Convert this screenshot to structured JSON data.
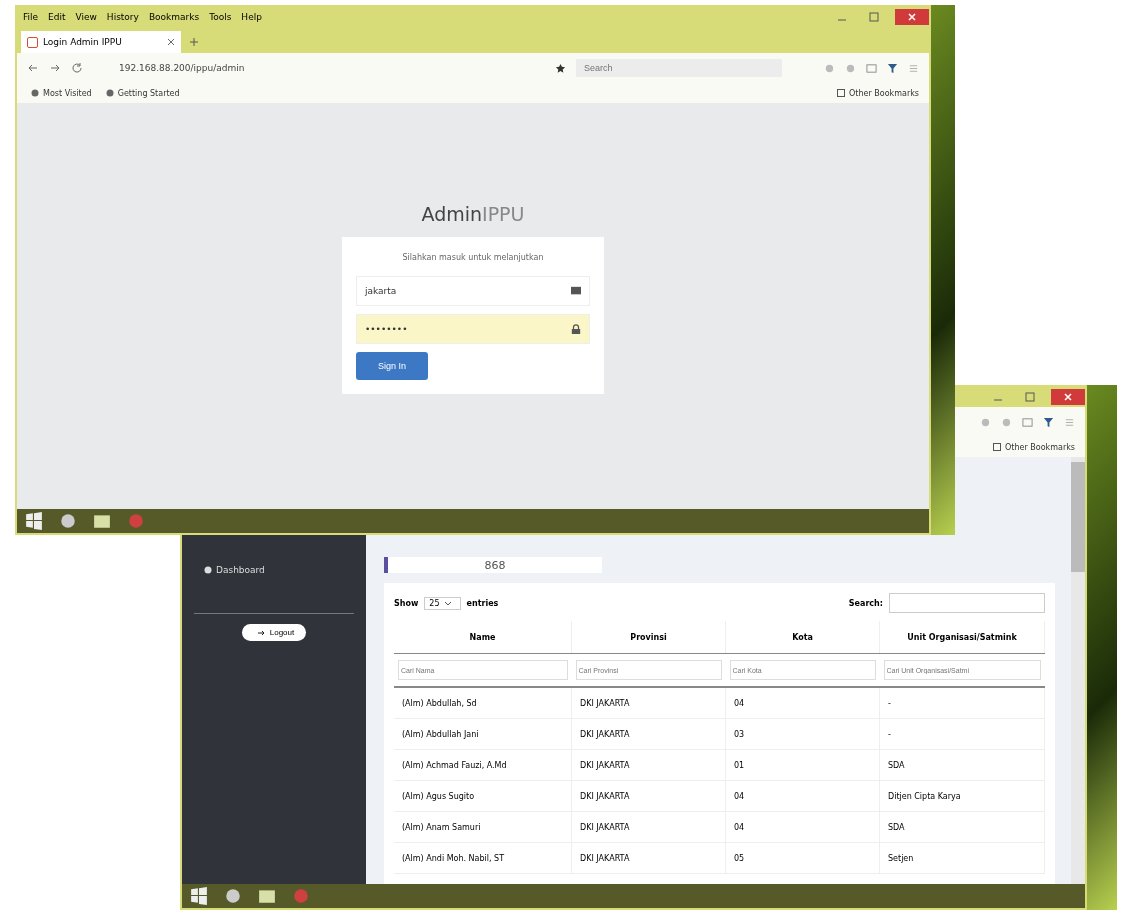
{
  "back_window": {
    "other_bookmarks": "Other Bookmarks",
    "sidebar": {
      "items": [
        {
          "label": "Dashboard",
          "selected": false
        }
      ],
      "logout": "Logout"
    },
    "stat_card": {
      "value": "868"
    },
    "table": {
      "show_label": "Show",
      "page_size": "25",
      "entries_label": "entries",
      "search_label": "Search:",
      "columns": [
        {
          "label": "Name",
          "filter_placeholder": "Cari Nama"
        },
        {
          "label": "Provinsi",
          "filter_placeholder": "Cari Provinsi"
        },
        {
          "label": "Kota",
          "filter_placeholder": "Cari Kota"
        },
        {
          "label": "Unit Organisasi/Satmink",
          "filter_placeholder": "Cari Unit Organisasi/Satmi"
        }
      ],
      "rows": [
        [
          "(Alm) Abdullah, Sd",
          "DKI JAKARTA",
          "04",
          "-"
        ],
        [
          "(Alm) Abdullah Jani",
          "DKI JAKARTA",
          "03",
          "-"
        ],
        [
          "(Alm) Achmad Fauzi, A.Md",
          "DKI JAKARTA",
          "01",
          "SDA"
        ],
        [
          "(Alm) Agus Sugito",
          "DKI JAKARTA",
          "04",
          "Ditjen Cipta Karya"
        ],
        [
          "(Alm) Anam Samuri",
          "DKI JAKARTA",
          "04",
          "SDA"
        ],
        [
          "(Alm) Andi Moh. Nabil, ST",
          "DKI JAKARTA",
          "05",
          "Setjen"
        ]
      ]
    }
  },
  "front_window": {
    "menu": [
      "File",
      "Edit",
      "View",
      "History",
      "Bookmarks",
      "Tools",
      "Help"
    ],
    "tab": {
      "title": "Login Admin IPPU"
    },
    "url": "192.168.88.200/ippu/admin",
    "search_placeholder": "Search",
    "bookmarks": [
      "Most Visited",
      "Getting Started"
    ],
    "other_bookmarks": "Other Bookmarks",
    "login": {
      "logo_first": "Admin",
      "logo_second": "IPPU",
      "prompt": "Silahkan masuk untuk melanjutkan",
      "username": "jakarta",
      "password": "••••••••",
      "button": "Sign In"
    }
  }
}
